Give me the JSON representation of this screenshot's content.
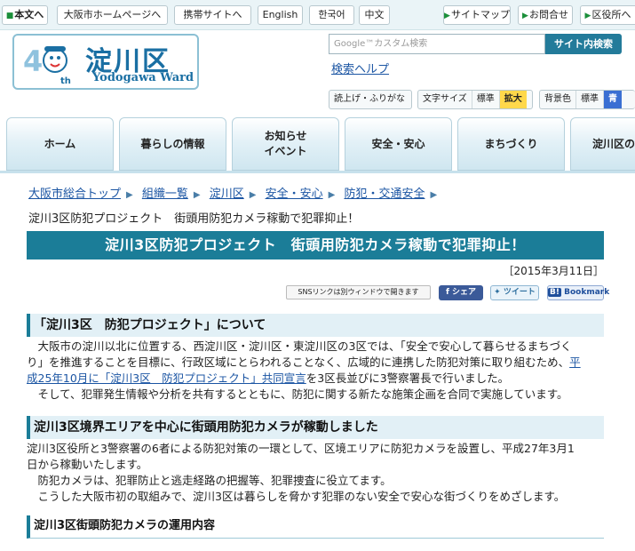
{
  "topbar": {
    "main_text": "本文へ",
    "osaka_home": "大阪市ホームページへ",
    "mobile": "携帯サイトへ",
    "english": "English",
    "korean": "한국어",
    "chinese": "中文",
    "sitemap": "サイトマップ",
    "contact": "お問合せ",
    "ward_office": "区役所へ"
  },
  "logo": {
    "number": "40",
    "th": "th",
    "title": "淀川区",
    "subtitle": "Yodogawa Ward"
  },
  "search": {
    "placeholder": "Google™カスタム検索",
    "button": "サイト内検索",
    "help": "検索ヘルプ"
  },
  "accessibility": {
    "read_aloud": "読上げ・ふりがな",
    "font_size_label": "文字サイズ",
    "font_standard": "標準",
    "font_large": "拡大",
    "bg_label": "背景色",
    "bg_standard": "標準",
    "bg_blue": "青"
  },
  "nav": {
    "home": "ホーム",
    "living": "暮らしの情報",
    "news_line1": "お知らせ",
    "news_line2": "イベント",
    "safety": "安全・安心",
    "town": "まちづくり",
    "ward_intro": "淀川区の"
  },
  "breadcrumb": {
    "items": [
      "大阪市総合トップ",
      "組織一覧",
      "淀川区",
      "安全・安心",
      "防犯・交通安全"
    ],
    "current": "淀川3区防犯プロジェクト　街頭用防犯カメラ稼動で犯罪抑止！"
  },
  "article": {
    "title": "淀川3区防犯プロジェクト　街頭用防犯カメラ稼動で犯罪抑止！",
    "date": "［2015年3月11日］"
  },
  "sns": {
    "note": "SNSリンクは別ウィンドウで開きます",
    "facebook": "シェア",
    "twitter": "ツイート",
    "hatena": "Bookmark"
  },
  "sections": {
    "s1_heading": "「淀川3区　防犯プロジェクト」について",
    "s1_line1": "　大阪市の淀川以北に位置する、西淀川区・淀川区・東淀川区の3区では、「安全で安心して暮らせるまちづく",
    "s1_line2_a": "り」を推進することを目標に、行政区域にとらわれることなく、広域的に連携した防犯対策に取り組むため、",
    "s1_line2_link": "平",
    "s1_line3_link": "成25年10月に「淀川3区　防犯プロジェクト」共同宣言",
    "s1_line3_b": "を3区長並びに3警察署長で行いました。",
    "s1_line4": "　そして、犯罪発生情報や分析を共有するとともに、防犯に関する新たな施策企画を合同で実施しています。",
    "s2_heading": "淀川3区境界エリアを中心に街頭用防犯カメラが稼動しました",
    "s2_line1": "淀川3区役所と3警察署の6者による防犯対策の一環として、区境エリアに防犯カメラを設置し、平成27年3月1",
    "s2_line2": "日から稼動いたします。",
    "s2_line3": "　防犯カメラは、犯罪防止と逃走経路の把握等、犯罪捜査に役立てます。",
    "s2_line4": "　こうした大阪市初の取組みで、淀川3区は暮らしを脅かす犯罪のない安全で安心な街づくりをめざします。",
    "s3_heading": "淀川3区街頭防犯カメラの運用内容"
  },
  "colors": {
    "accent": "#1b7d98",
    "link": "#1b55a3",
    "logo_blue": "#1a6fa3",
    "highlight_yellow": "#ffd84a"
  }
}
